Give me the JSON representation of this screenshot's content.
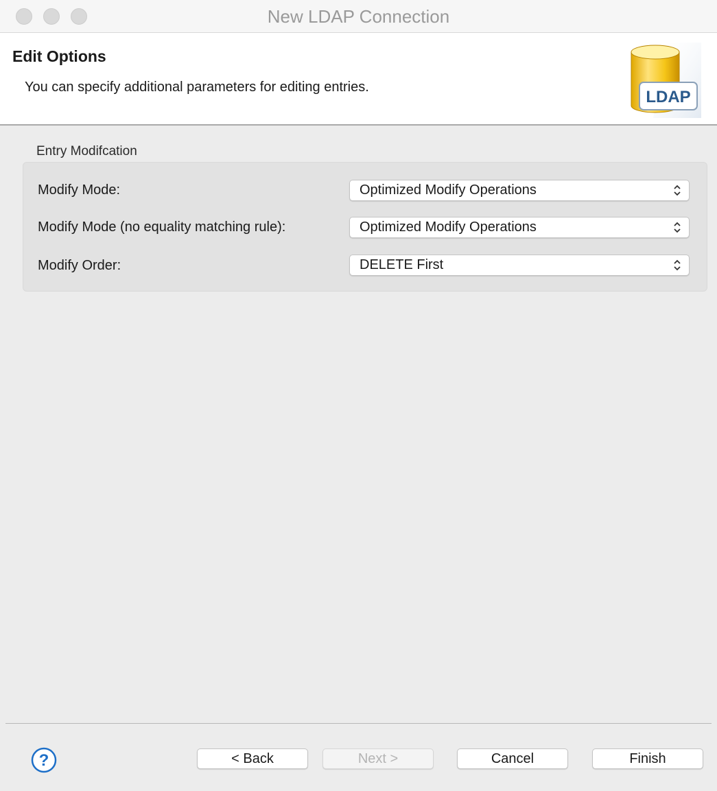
{
  "window": {
    "title": "New LDAP Connection"
  },
  "header": {
    "title": "Edit Options",
    "description": "You can specify additional parameters for editing entries.",
    "icon_label": "LDAP"
  },
  "group": {
    "title": "Entry Modifcation",
    "rows": [
      {
        "label": "Modify Mode:",
        "value": "Optimized Modify Operations"
      },
      {
        "label": "Modify Mode (no equality matching rule):",
        "value": "Optimized Modify Operations"
      },
      {
        "label": "Modify Order:",
        "value": "DELETE First"
      }
    ]
  },
  "footer": {
    "back_label": "< Back",
    "next_label": "Next >",
    "cancel_label": "Cancel",
    "finish_label": "Finish",
    "next_enabled": false
  },
  "colors": {
    "window_bg": "#ececec",
    "header_bg": "#ffffff",
    "ldap_text": "#2a5a8c",
    "ldap_cylinder": "#f5c518",
    "help_icon": "#1d6fc8"
  }
}
